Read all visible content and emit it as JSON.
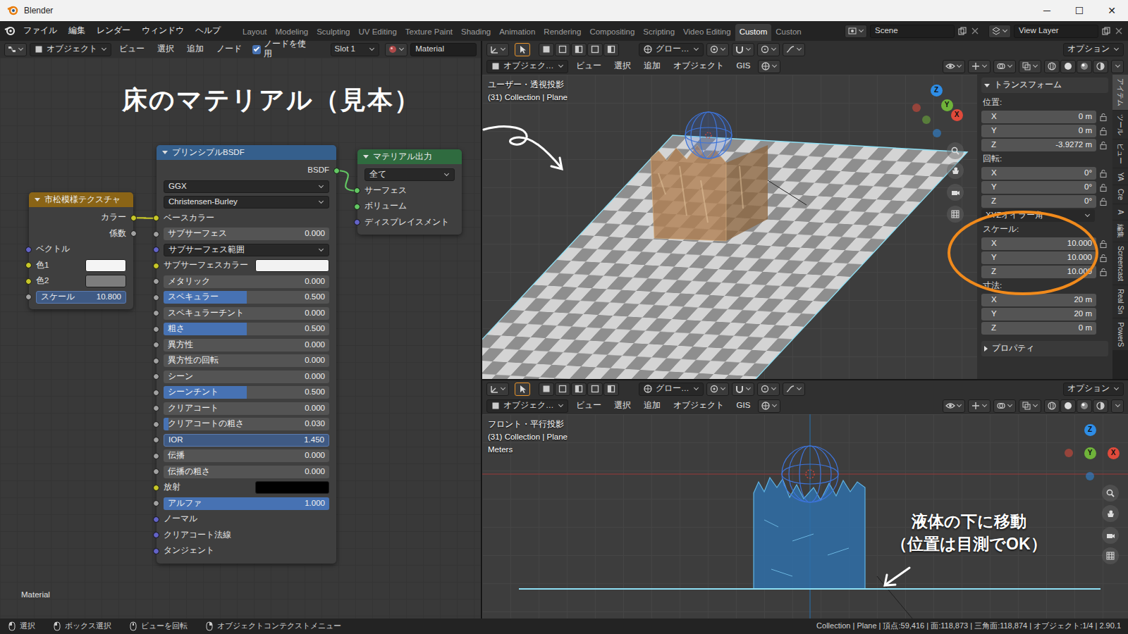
{
  "window": {
    "title": "Blender",
    "controls": [
      "─",
      "☐",
      "✕"
    ]
  },
  "topbar": {
    "menus": [
      "ファイル",
      "編集",
      "レンダー",
      "ウィンドウ",
      "ヘルプ"
    ],
    "workspaces": [
      {
        "label": "Layout",
        "selected": false
      },
      {
        "label": "Modeling",
        "selected": false
      },
      {
        "label": "Sculpting",
        "selected": false
      },
      {
        "label": "UV Editing",
        "selected": false
      },
      {
        "label": "Texture Paint",
        "selected": false
      },
      {
        "label": "Shading",
        "selected": false
      },
      {
        "label": "Animation",
        "selected": false
      },
      {
        "label": "Rendering",
        "selected": false
      },
      {
        "label": "Compositing",
        "selected": false
      },
      {
        "label": "Scripting",
        "selected": false
      },
      {
        "label": "Video Editing",
        "selected": false
      },
      {
        "label": "Custom",
        "selected": true
      },
      {
        "label": "Custon",
        "selected": false
      }
    ],
    "scene": "Scene",
    "view_layer": "View Layer"
  },
  "node_editor": {
    "header": {
      "mode": "オブジェクト",
      "menus": [
        "ビュー",
        "選択",
        "追加",
        "ノード"
      ],
      "use_nodes": {
        "label": "ノードを使用",
        "checked": true
      },
      "slot": "Slot 1",
      "material": "Material"
    },
    "annotation": "床のマテリアル（見本）",
    "footer": "Material",
    "checker": {
      "title": "市松模様テクスチャ",
      "outputs": [
        {
          "label": "カラー",
          "socket": "#c7c729"
        },
        {
          "label": "係数",
          "socket": "#a1a1a1"
        }
      ],
      "inputs": [
        {
          "label": "ベクトル",
          "kind": "socket",
          "socket": "#6363c7"
        },
        {
          "label": "色1",
          "kind": "color",
          "swatch": "#f4f4f4",
          "socket": "#c7c729"
        },
        {
          "label": "色2",
          "kind": "color",
          "swatch": "#7d7d7d",
          "socket": "#c7c729"
        },
        {
          "label": "スケール",
          "kind": "field",
          "value": "10.800",
          "socket": "#a1a1a1"
        }
      ]
    },
    "bsdf": {
      "title": "プリンシプルBSDF",
      "output": {
        "label": "BSDF",
        "socket": "#63c763"
      },
      "dropdowns": [
        "GGX",
        "Christensen-Burley"
      ],
      "rows": [
        {
          "label": "ベースカラー",
          "kind": "linked",
          "socket": "#c7c729"
        },
        {
          "label": "サブサーフェス",
          "kind": "slider",
          "value": "0.000",
          "level": 0,
          "socket": "#a1a1a1"
        },
        {
          "label": "サブサーフェス範囲",
          "kind": "dropdown",
          "socket": "#6363c7"
        },
        {
          "label": "サブサーフェスカラー",
          "kind": "color",
          "swatch": "#f2f2f2",
          "socket": "#c7c729"
        },
        {
          "label": "メタリック",
          "kind": "slider",
          "value": "0.000",
          "level": 0,
          "socket": "#a1a1a1"
        },
        {
          "label": "スペキュラー",
          "kind": "slider",
          "value": "0.500",
          "level": 0.5,
          "socket": "#a1a1a1"
        },
        {
          "label": "スペキュラーチント",
          "kind": "slider",
          "value": "0.000",
          "level": 0,
          "socket": "#a1a1a1"
        },
        {
          "label": "粗さ",
          "kind": "slider",
          "value": "0.500",
          "level": 0.5,
          "socket": "#a1a1a1"
        },
        {
          "label": "異方性",
          "kind": "slider",
          "value": "0.000",
          "level": 0,
          "socket": "#a1a1a1"
        },
        {
          "label": "異方性の回転",
          "kind": "slider",
          "value": "0.000",
          "level": 0,
          "socket": "#a1a1a1"
        },
        {
          "label": "シーン",
          "kind": "slider",
          "value": "0.000",
          "level": 0,
          "socket": "#a1a1a1"
        },
        {
          "label": "シーンチント",
          "kind": "slider",
          "value": "0.500",
          "level": 0.5,
          "socket": "#a1a1a1"
        },
        {
          "label": "クリアコート",
          "kind": "slider",
          "value": "0.000",
          "level": 0,
          "socket": "#a1a1a1"
        },
        {
          "label": "クリアコートの粗さ",
          "kind": "slider",
          "value": "0.030",
          "level": 0.03,
          "socket": "#a1a1a1"
        },
        {
          "label": "IOR",
          "kind": "field",
          "value": "1.450",
          "socket": "#a1a1a1"
        },
        {
          "label": "伝播",
          "kind": "slider",
          "value": "0.000",
          "level": 0,
          "socket": "#a1a1a1"
        },
        {
          "label": "伝播の粗さ",
          "kind": "slider",
          "value": "0.000",
          "level": 0,
          "socket": "#a1a1a1"
        },
        {
          "label": "放射",
          "kind": "color",
          "swatch": "#000000",
          "socket": "#c7c729"
        },
        {
          "label": "アルファ",
          "kind": "slider",
          "value": "1.000",
          "level": 1,
          "socket": "#a1a1a1"
        },
        {
          "label": "ノーマル",
          "kind": "socket",
          "socket": "#6363c7"
        },
        {
          "label": "クリアコート法線",
          "kind": "socket",
          "socket": "#6363c7"
        },
        {
          "label": "タンジェント",
          "kind": "socket",
          "socket": "#6363c7"
        }
      ]
    },
    "output": {
      "title": "マテリアル出力",
      "target": "全て",
      "inputs": [
        {
          "label": "サーフェス",
          "socket": "#63c763"
        },
        {
          "label": "ボリューム",
          "socket": "#63c763"
        },
        {
          "label": "ディスプレイスメント",
          "socket": "#6363c7"
        }
      ]
    }
  },
  "viewport_top": {
    "header": {
      "transform": "グロー…",
      "options": "オプション",
      "mode": "オブジェク…",
      "menus": [
        "ビュー",
        "選択",
        "追加",
        "オブジェクト",
        "GIS"
      ]
    },
    "overlay": [
      "ユーザー・透視投影",
      "(31) Collection | Plane"
    ],
    "gizmo": [
      {
        "label": "Z",
        "color": "#2e8de6"
      },
      {
        "label": "Y",
        "color": "#6fb33a"
      },
      {
        "label": "X",
        "color": "#e04a3b"
      }
    ],
    "npanel": {
      "title": "トランスフォーム",
      "items": [
        {
          "kind": "group",
          "label": "位置:",
          "lockable": true,
          "fields": [
            {
              "axis": "X",
              "value": "0 m"
            },
            {
              "axis": "Y",
              "value": "0 m"
            },
            {
              "axis": "Z",
              "value": "-3.9272 m"
            }
          ]
        },
        {
          "kind": "group",
          "label": "回転:",
          "lockable": true,
          "fields": [
            {
              "axis": "X",
              "value": "0°"
            },
            {
              "axis": "Y",
              "value": "0°"
            },
            {
              "axis": "Z",
              "value": "0°"
            }
          ]
        },
        {
          "kind": "dropdown",
          "label": "XYZオイラー角"
        },
        {
          "kind": "group",
          "label": "スケール:",
          "lockable": true,
          "fields": [
            {
              "axis": "X",
              "value": "10.000"
            },
            {
              "axis": "Y",
              "value": "10.000"
            },
            {
              "axis": "Z",
              "value": "10.000"
            }
          ]
        },
        {
          "kind": "group",
          "label": "寸法:",
          "lockable": false,
          "fields": [
            {
              "axis": "X",
              "value": "20 m"
            },
            {
              "axis": "Y",
              "value": "20 m"
            },
            {
              "axis": "Z",
              "value": "0 m"
            }
          ]
        }
      ],
      "properties": "プロパティ"
    },
    "tabs": [
      {
        "label": "アイテム",
        "selected": true
      },
      {
        "label": "ツール",
        "selected": false
      },
      {
        "label": "ビュー",
        "selected": false
      },
      {
        "label": "YA",
        "selected": false
      },
      {
        "label": "Cre",
        "selected": false
      },
      {
        "label": "A",
        "selected": false
      },
      {
        "label": "編集",
        "selected": false
      },
      {
        "label": "Screencast",
        "selected": false
      },
      {
        "label": "Real Sn",
        "selected": false
      },
      {
        "label": "PowerS",
        "selected": false
      }
    ]
  },
  "viewport_bottom": {
    "header": {
      "transform": "グロー…",
      "options": "オプション",
      "mode": "オブジェク…",
      "menus": [
        "ビュー",
        "選択",
        "追加",
        "オブジェクト",
        "GIS"
      ]
    },
    "overlay": [
      "フロント・平行投影",
      "(31) Collection | Plane",
      "Meters"
    ],
    "gizmo": [
      {
        "label": "Z",
        "color": "#2e8de6"
      },
      {
        "label": "Y",
        "color": "#6fb33a"
      },
      {
        "label": "X",
        "color": "#e04a3b"
      }
    ],
    "annotation": [
      "液体の下に移動",
      "（位置は目測でOK）"
    ]
  },
  "status_bar": {
    "hints": [
      "選択",
      "ボックス選択",
      "ビューを回転",
      "オブジェクトコンテクストメニュー"
    ],
    "info": "Collection | Plane | 頂点:59,416 | 面:118,873 | 三角面:118,874 | オブジェクト:1/4 | 2.90.1"
  }
}
